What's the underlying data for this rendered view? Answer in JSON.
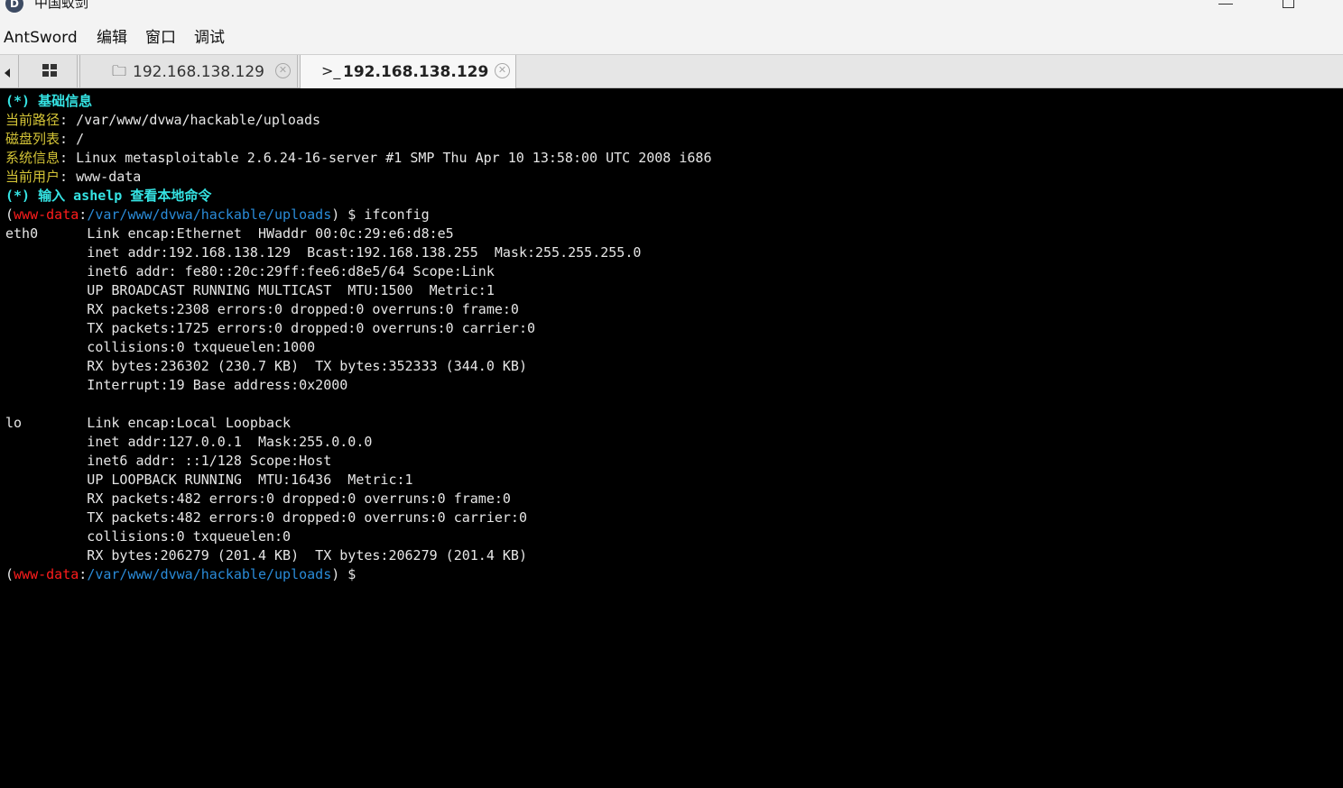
{
  "window": {
    "title": "中国蚁剑",
    "app_icon_glyph": "D"
  },
  "menubar": {
    "items": [
      "AntSword",
      "编辑",
      "窗口",
      "调试"
    ]
  },
  "tabs": {
    "files": {
      "icon": "folder-icon",
      "label": "192.168.138.129"
    },
    "terminal": {
      "icon": "terminal-icon",
      "label": "192.168.138.129"
    }
  },
  "colors": {
    "cyan": "#35e3e3",
    "label_yellow": "#d4c437",
    "prompt_user": "#ff1c1c",
    "prompt_path": "#2a8bd8"
  },
  "terminal": {
    "info_header": "(*) 基础信息",
    "info": [
      {
        "label": "当前路径",
        "value": ": /var/www/dvwa/hackable/uploads"
      },
      {
        "label": "磁盘列表",
        "value": ": /"
      },
      {
        "label": "系统信息",
        "value": ": Linux metasploitable 2.6.24-16-server #1 SMP Thu Apr 10 13:58:00 UTC 2008 i686"
      },
      {
        "label": "当前用户",
        "value": ": www-data"
      }
    ],
    "help_line": "(*) 输入 ashelp 查看本地命令",
    "prompt": {
      "open": "(",
      "user": "www-data",
      "sep": ":",
      "path": "/var/www/dvwa/hackable/uploads",
      "close": ") $ "
    },
    "command": "ifconfig",
    "output": [
      "eth0      Link encap:Ethernet  HWaddr 00:0c:29:e6:d8:e5  ",
      "          inet addr:192.168.138.129  Bcast:192.168.138.255  Mask:255.255.255.0",
      "          inet6 addr: fe80::20c:29ff:fee6:d8e5/64 Scope:Link",
      "          UP BROADCAST RUNNING MULTICAST  MTU:1500  Metric:1",
      "          RX packets:2308 errors:0 dropped:0 overruns:0 frame:0",
      "          TX packets:1725 errors:0 dropped:0 overruns:0 carrier:0",
      "          collisions:0 txqueuelen:1000 ",
      "          RX bytes:236302 (230.7 KB)  TX bytes:352333 (344.0 KB)",
      "          Interrupt:19 Base address:0x2000 ",
      "",
      "lo        Link encap:Local Loopback  ",
      "          inet addr:127.0.0.1  Mask:255.0.0.0",
      "          inet6 addr: ::1/128 Scope:Host",
      "          UP LOOPBACK RUNNING  MTU:16436  Metric:1",
      "          RX packets:482 errors:0 dropped:0 overruns:0 frame:0",
      "          TX packets:482 errors:0 dropped:0 overruns:0 carrier:0",
      "          collisions:0 txqueuelen:0 ",
      "          RX bytes:206279 (201.4 KB)  TX bytes:206279 (201.4 KB)"
    ]
  }
}
